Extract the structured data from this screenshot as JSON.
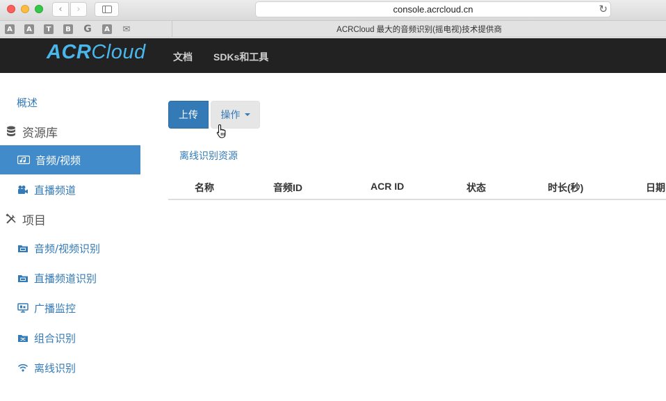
{
  "browser": {
    "url": "console.acrcloud.cn",
    "tab_title": "ACRCloud 最大的音频识别(摇电视)技术提供商",
    "bookmark_icons": [
      {
        "glyph": "A",
        "icon": "bookmark-a-icon"
      },
      {
        "glyph": "A",
        "icon": "bookmark-a-icon"
      },
      {
        "glyph": "T",
        "icon": "bookmark-t-icon"
      },
      {
        "glyph": "B",
        "icon": "bookmark-b-icon"
      },
      {
        "glyph": "G",
        "icon": "google-icon"
      },
      {
        "glyph": "A",
        "icon": "bookmark-a-icon"
      },
      {
        "glyph": "✉",
        "icon": "mail-icon"
      }
    ]
  },
  "header": {
    "logo_bold": "ACR",
    "logo_rest": "Cloud",
    "nav_docs": "文档",
    "nav_sdk": "SDKs和工具"
  },
  "sidebar": {
    "overview": "概述",
    "resources_heading": "资源库",
    "audio_video": "音频/视频",
    "live_channels": "直播频道",
    "projects_heading": "项目",
    "av_recognition": "音频/视频识别",
    "channel_recognition": "直播频道识别",
    "broadcast_monitoring": "广播监控",
    "hybrid_recognition": "组合识别",
    "offline_recognition": "离线识别"
  },
  "main": {
    "upload_label": "上传",
    "actions_label": "操作",
    "offline_resources_link": "离线识别资源",
    "columns": [
      "名称",
      "音频ID",
      "ACR ID",
      "状态",
      "时长(秒)",
      "日期"
    ]
  },
  "colors": {
    "accent": "#337ab7",
    "active_item": "#428bca",
    "logo": "#4ab7ec",
    "header_bg": "#222222"
  }
}
